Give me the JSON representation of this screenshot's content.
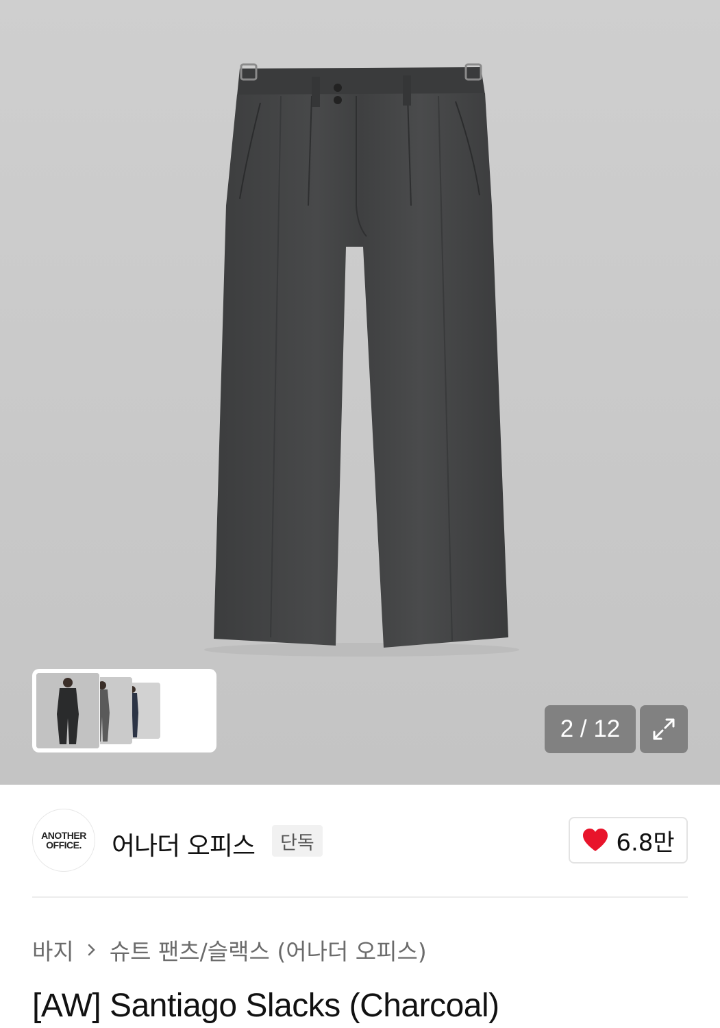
{
  "gallery": {
    "counter": "2 / 12",
    "expand_icon": "expand-icon",
    "thumbnails": [
      "thumbnail-1",
      "thumbnail-2",
      "thumbnail-3"
    ]
  },
  "brand": {
    "logo_line1": "ANOTHER",
    "logo_line2": "OFFICE.",
    "name": "어나더 오피스",
    "badge": "단독"
  },
  "like": {
    "icon": "heart-icon",
    "color": "#e8142b",
    "count": "6.8만"
  },
  "breadcrumb": {
    "category": "바지",
    "subcategory": "슈트 팬츠/슬랙스 (어나더 오피스)"
  },
  "product": {
    "title": "[AW] Santiago Slacks (Charcoal)"
  }
}
